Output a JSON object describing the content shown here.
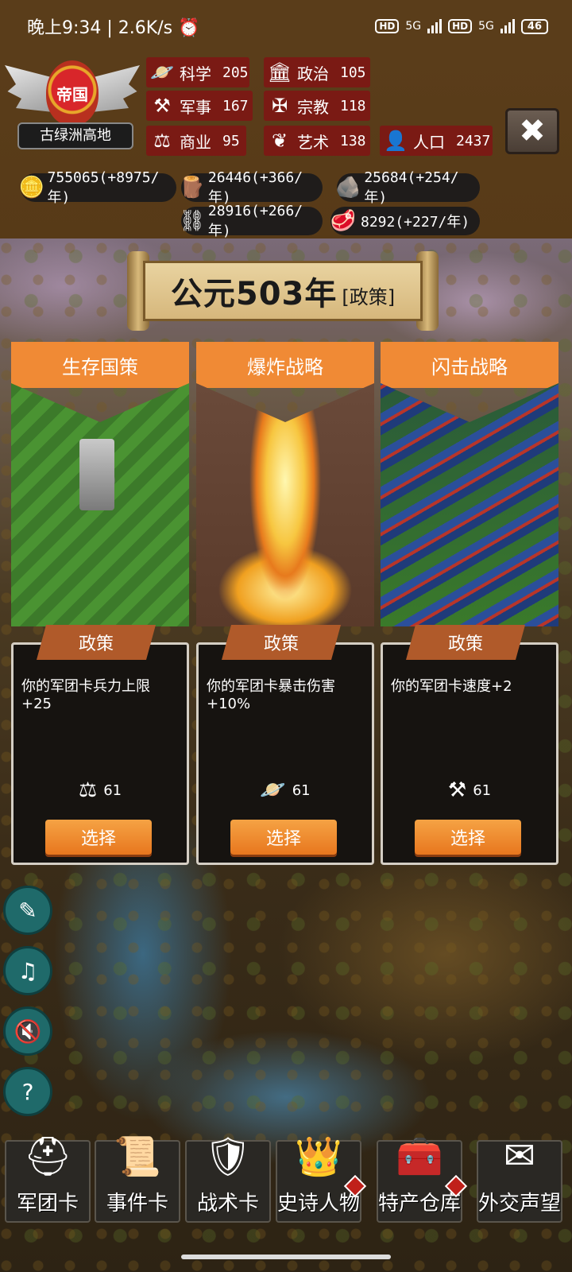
{
  "status_bar": {
    "time_speed": "晚上9:34 | 2.6K/s",
    "alarm_icon": "alarm-icon",
    "hd1": "HD",
    "sig1": "5G",
    "hd2": "HD",
    "sig2": "5G",
    "battery": "46"
  },
  "empire": {
    "rank": "帝国",
    "region": "古绿洲高地"
  },
  "attributes": {
    "science": {
      "label": "科学",
      "value": "205"
    },
    "politics": {
      "label": "政治",
      "value": "105"
    },
    "military": {
      "label": "军事",
      "value": "167"
    },
    "religion": {
      "label": "宗教",
      "value": "118"
    },
    "commerce": {
      "label": "商业",
      "value": "95"
    },
    "art": {
      "label": "艺术",
      "value": "138"
    },
    "population": {
      "label": "人口",
      "value": "2437"
    }
  },
  "resources": {
    "gold": "755065(+8975/年)",
    "wood": "26446(+366/年)",
    "stone": "25684(+254/年)",
    "iron": "28916(+266/年)",
    "meat": "8292(+227/年)"
  },
  "banner": {
    "year": "公元503年",
    "tag": "[政策]"
  },
  "cards": [
    {
      "title": "生存国策",
      "ribbon": "政策",
      "desc": "你的军团卡兵力上限+25",
      "cost_icon": "scales-icon",
      "cost": "61",
      "button": "选择"
    },
    {
      "title": "爆炸战略",
      "ribbon": "政策",
      "desc": "你的军团卡暴击伤害+10%",
      "cost_icon": "planet-icon",
      "cost": "61",
      "button": "选择"
    },
    {
      "title": "闪击战略",
      "ribbon": "政策",
      "desc": "你的军团卡速度+2",
      "cost_icon": "crossed-hammers-icon",
      "cost": "61",
      "button": "选择"
    }
  ],
  "nav": [
    {
      "label": "军团卡",
      "icon": "helmet-icon"
    },
    {
      "label": "事件卡",
      "icon": "scroll-icon"
    },
    {
      "label": "战术卡",
      "icon": "shield-swords-icon"
    },
    {
      "label": "史诗人物",
      "icon": "crown-icon"
    },
    {
      "label": "特产仓库",
      "icon": "treasure-chest-icon"
    },
    {
      "label": "外交声望",
      "icon": "envelope-icon"
    }
  ],
  "colors": {
    "header_bg": "#5a3d1a",
    "attr_bg": "#7a1a14",
    "card_title": "#f08a35",
    "button": "#e8771e"
  }
}
